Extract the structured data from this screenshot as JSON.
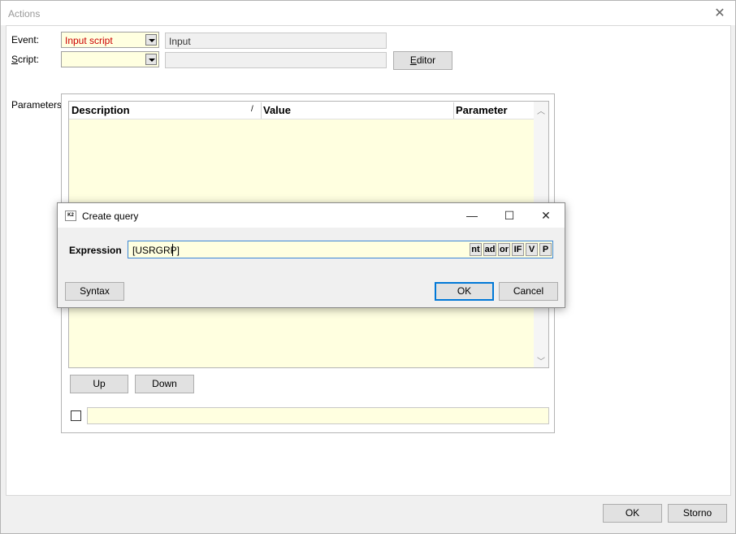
{
  "window": {
    "title": "Actions"
  },
  "form": {
    "event_label": "Event:",
    "event_value": "Input script",
    "event_display": "Input",
    "script_label": "Script:",
    "script_value": "",
    "script_display": "",
    "editor_button": "Editor",
    "parameters_label": "Parameters:"
  },
  "grid": {
    "columns": [
      "Description",
      "Value",
      "Parameter"
    ],
    "sort_indicator": "/",
    "rows": []
  },
  "panel": {
    "up_button": "Up",
    "down_button": "Down",
    "bottom_value": ""
  },
  "dialog": {
    "title": "Create query",
    "app_icon_text": "K2",
    "expression_label": "Expression",
    "expression_value": "[USRGRP]",
    "operators": [
      "nt",
      "ad",
      "or",
      "IF",
      "V",
      "P"
    ],
    "syntax_button": "Syntax",
    "ok_button": "OK",
    "cancel_button": "Cancel"
  },
  "footer": {
    "ok_button": "OK",
    "storno_button": "Storno"
  },
  "colors": {
    "field_background": "#ffffe0",
    "event_text": "#cc0000",
    "focus_border": "#0078d7"
  }
}
